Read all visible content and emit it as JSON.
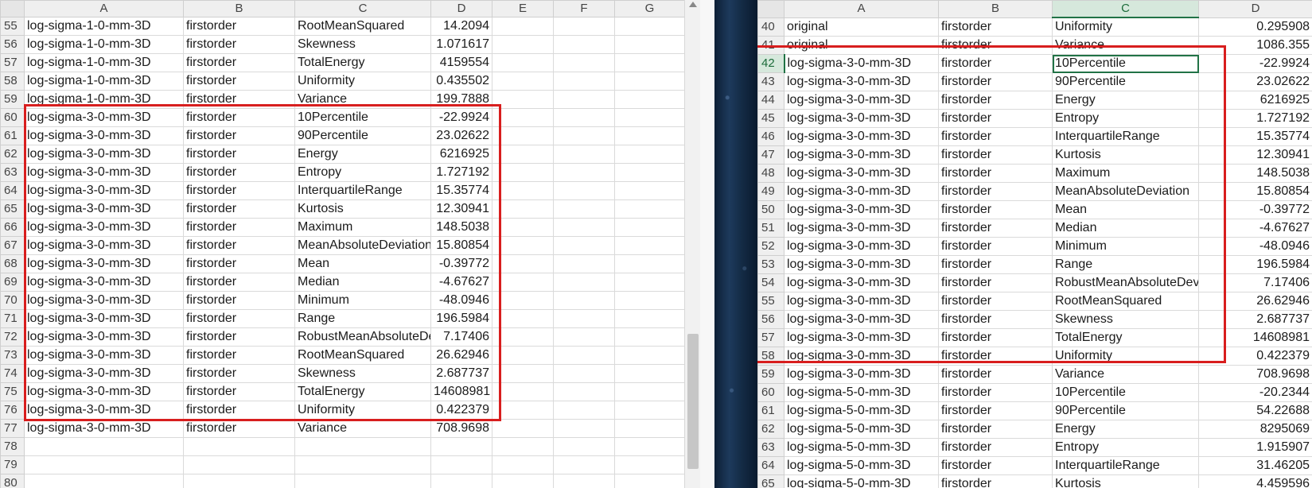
{
  "left": {
    "columns": [
      "A",
      "B",
      "C",
      "D",
      "E",
      "F",
      "G"
    ],
    "rows": [
      {
        "n": "55",
        "a": "log-sigma-1-0-mm-3D",
        "b": "firstorder",
        "c": "RootMeanSquared",
        "d": "14.2094"
      },
      {
        "n": "56",
        "a": "log-sigma-1-0-mm-3D",
        "b": "firstorder",
        "c": "Skewness",
        "d": "1.071617"
      },
      {
        "n": "57",
        "a": "log-sigma-1-0-mm-3D",
        "b": "firstorder",
        "c": "TotalEnergy",
        "d": "4159554"
      },
      {
        "n": "58",
        "a": "log-sigma-1-0-mm-3D",
        "b": "firstorder",
        "c": "Uniformity",
        "d": "0.435502"
      },
      {
        "n": "59",
        "a": "log-sigma-1-0-mm-3D",
        "b": "firstorder",
        "c": "Variance",
        "d": "199.7888"
      },
      {
        "n": "60",
        "a": "log-sigma-3-0-mm-3D",
        "b": "firstorder",
        "c": "10Percentile",
        "d": "-22.9924"
      },
      {
        "n": "61",
        "a": "log-sigma-3-0-mm-3D",
        "b": "firstorder",
        "c": "90Percentile",
        "d": "23.02622"
      },
      {
        "n": "62",
        "a": "log-sigma-3-0-mm-3D",
        "b": "firstorder",
        "c": "Energy",
        "d": "6216925"
      },
      {
        "n": "63",
        "a": "log-sigma-3-0-mm-3D",
        "b": "firstorder",
        "c": "Entropy",
        "d": "1.727192"
      },
      {
        "n": "64",
        "a": "log-sigma-3-0-mm-3D",
        "b": "firstorder",
        "c": "InterquartileRange",
        "d": "15.35774"
      },
      {
        "n": "65",
        "a": "log-sigma-3-0-mm-3D",
        "b": "firstorder",
        "c": "Kurtosis",
        "d": "12.30941"
      },
      {
        "n": "66",
        "a": "log-sigma-3-0-mm-3D",
        "b": "firstorder",
        "c": "Maximum",
        "d": "148.5038"
      },
      {
        "n": "67",
        "a": "log-sigma-3-0-mm-3D",
        "b": "firstorder",
        "c": "MeanAbsoluteDeviation",
        "d": "15.80854"
      },
      {
        "n": "68",
        "a": "log-sigma-3-0-mm-3D",
        "b": "firstorder",
        "c": "Mean",
        "d": "-0.39772"
      },
      {
        "n": "69",
        "a": "log-sigma-3-0-mm-3D",
        "b": "firstorder",
        "c": "Median",
        "d": "-4.67627"
      },
      {
        "n": "70",
        "a": "log-sigma-3-0-mm-3D",
        "b": "firstorder",
        "c": "Minimum",
        "d": "-48.0946"
      },
      {
        "n": "71",
        "a": "log-sigma-3-0-mm-3D",
        "b": "firstorder",
        "c": "Range",
        "d": "196.5984"
      },
      {
        "n": "72",
        "a": "log-sigma-3-0-mm-3D",
        "b": "firstorder",
        "c": "RobustMeanAbsoluteDeviation",
        "d": "7.17406"
      },
      {
        "n": "73",
        "a": "log-sigma-3-0-mm-3D",
        "b": "firstorder",
        "c": "RootMeanSquared",
        "d": "26.62946"
      },
      {
        "n": "74",
        "a": "log-sigma-3-0-mm-3D",
        "b": "firstorder",
        "c": "Skewness",
        "d": "2.687737"
      },
      {
        "n": "75",
        "a": "log-sigma-3-0-mm-3D",
        "b": "firstorder",
        "c": "TotalEnergy",
        "d": "14608981"
      },
      {
        "n": "76",
        "a": "log-sigma-3-0-mm-3D",
        "b": "firstorder",
        "c": "Uniformity",
        "d": "0.422379"
      },
      {
        "n": "77",
        "a": "log-sigma-3-0-mm-3D",
        "b": "firstorder",
        "c": "Variance",
        "d": "708.9698"
      },
      {
        "n": "78",
        "a": "",
        "b": "",
        "c": "",
        "d": ""
      },
      {
        "n": "79",
        "a": "",
        "b": "",
        "c": "",
        "d": ""
      },
      {
        "n": "80",
        "a": "",
        "b": "",
        "c": "",
        "d": ""
      }
    ]
  },
  "right": {
    "columns": [
      "A",
      "B",
      "C",
      "D"
    ],
    "active_column": "C",
    "active_row": "42",
    "rows": [
      {
        "n": "40",
        "a": "original",
        "b": "firstorder",
        "c": "Uniformity",
        "d": "0.295908"
      },
      {
        "n": "41",
        "a": "original",
        "b": "firstorder",
        "c": "Variance",
        "d": "1086.355"
      },
      {
        "n": "42",
        "a": "log-sigma-3-0-mm-3D",
        "b": "firstorder",
        "c": "10Percentile",
        "d": "-22.9924"
      },
      {
        "n": "43",
        "a": "log-sigma-3-0-mm-3D",
        "b": "firstorder",
        "c": "90Percentile",
        "d": "23.02622"
      },
      {
        "n": "44",
        "a": "log-sigma-3-0-mm-3D",
        "b": "firstorder",
        "c": "Energy",
        "d": "6216925"
      },
      {
        "n": "45",
        "a": "log-sigma-3-0-mm-3D",
        "b": "firstorder",
        "c": "Entropy",
        "d": "1.727192"
      },
      {
        "n": "46",
        "a": "log-sigma-3-0-mm-3D",
        "b": "firstorder",
        "c": "InterquartileRange",
        "d": "15.35774"
      },
      {
        "n": "47",
        "a": "log-sigma-3-0-mm-3D",
        "b": "firstorder",
        "c": "Kurtosis",
        "d": "12.30941"
      },
      {
        "n": "48",
        "a": "log-sigma-3-0-mm-3D",
        "b": "firstorder",
        "c": "Maximum",
        "d": "148.5038"
      },
      {
        "n": "49",
        "a": "log-sigma-3-0-mm-3D",
        "b": "firstorder",
        "c": "MeanAbsoluteDeviation",
        "d": "15.80854"
      },
      {
        "n": "50",
        "a": "log-sigma-3-0-mm-3D",
        "b": "firstorder",
        "c": "Mean",
        "d": "-0.39772"
      },
      {
        "n": "51",
        "a": "log-sigma-3-0-mm-3D",
        "b": "firstorder",
        "c": "Median",
        "d": "-4.67627"
      },
      {
        "n": "52",
        "a": "log-sigma-3-0-mm-3D",
        "b": "firstorder",
        "c": "Minimum",
        "d": "-48.0946"
      },
      {
        "n": "53",
        "a": "log-sigma-3-0-mm-3D",
        "b": "firstorder",
        "c": "Range",
        "d": "196.5984"
      },
      {
        "n": "54",
        "a": "log-sigma-3-0-mm-3D",
        "b": "firstorder",
        "c": "RobustMeanAbsoluteDeviation",
        "d": "7.17406"
      },
      {
        "n": "55",
        "a": "log-sigma-3-0-mm-3D",
        "b": "firstorder",
        "c": "RootMeanSquared",
        "d": "26.62946"
      },
      {
        "n": "56",
        "a": "log-sigma-3-0-mm-3D",
        "b": "firstorder",
        "c": "Skewness",
        "d": "2.687737"
      },
      {
        "n": "57",
        "a": "log-sigma-3-0-mm-3D",
        "b": "firstorder",
        "c": "TotalEnergy",
        "d": "14608981"
      },
      {
        "n": "58",
        "a": "log-sigma-3-0-mm-3D",
        "b": "firstorder",
        "c": "Uniformity",
        "d": "0.422379"
      },
      {
        "n": "59",
        "a": "log-sigma-3-0-mm-3D",
        "b": "firstorder",
        "c": "Variance",
        "d": "708.9698"
      },
      {
        "n": "60",
        "a": "log-sigma-5-0-mm-3D",
        "b": "firstorder",
        "c": "10Percentile",
        "d": "-20.2344"
      },
      {
        "n": "61",
        "a": "log-sigma-5-0-mm-3D",
        "b": "firstorder",
        "c": "90Percentile",
        "d": "54.22688"
      },
      {
        "n": "62",
        "a": "log-sigma-5-0-mm-3D",
        "b": "firstorder",
        "c": "Energy",
        "d": "8295069"
      },
      {
        "n": "63",
        "a": "log-sigma-5-0-mm-3D",
        "b": "firstorder",
        "c": "Entropy",
        "d": "1.915907"
      },
      {
        "n": "64",
        "a": "log-sigma-5-0-mm-3D",
        "b": "firstorder",
        "c": "InterquartileRange",
        "d": "31.46205"
      },
      {
        "n": "65",
        "a": "log-sigma-5-0-mm-3D",
        "b": "firstorder",
        "c": "Kurtosis",
        "d": "4.459596"
      }
    ]
  },
  "colors": {
    "highlight": "#d81e1e",
    "selection": "#217346",
    "header_bg": "#efefef"
  }
}
